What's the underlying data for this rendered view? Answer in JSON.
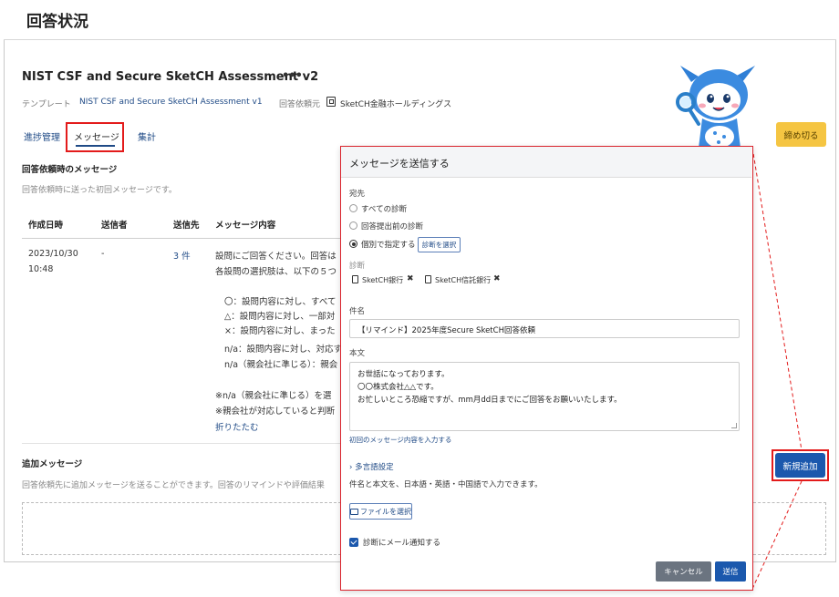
{
  "page": {
    "title": "回答状況"
  },
  "assessment": {
    "title": "NIST CSF and Secure SketCH Assessment v2",
    "more": "•••",
    "template_label": "テンプレート",
    "template_value": "NIST CSF and Secure SketCH Assessment v1",
    "requester_label": "回答依頼元",
    "requester_value": "SketCH金融ホールディングス"
  },
  "tabs": [
    {
      "label": "進捗管理"
    },
    {
      "label": "メッセージ"
    },
    {
      "label": "集計"
    }
  ],
  "request_message": {
    "heading": "回答依頼時のメッセージ",
    "description": "回答依頼時に送った初回メッセージです。",
    "columns": [
      "作成日時",
      "送信者",
      "送信先",
      "メッセージ内容"
    ],
    "row": {
      "date": "2023/10/30",
      "time": "10:48",
      "sender": "-",
      "recipients": "3 件",
      "lines": [
        "設問にご回答ください。回答は",
        "各設問の選択肢は、以下の５つ",
        "",
        "〇：設問内容に対し、すべて",
        "△：設問内容に対し、一部対",
        "×：設問内容に対し、まった",
        "n/a：設問内容に対し、対応す",
        "n/a（親会社に準じる）：親会",
        "",
        "※n/a（親会社に準じる）を選",
        "※親会社が対応していると判断"
      ],
      "collapse": "折りたたむ"
    }
  },
  "additional": {
    "heading": "追加メッセージ",
    "description": "回答依頼先に追加メッセージを送ることができます。回答のリマインドや評価結果"
  },
  "buttons": {
    "close_answers": "締め切る",
    "new": "新規追加"
  },
  "modal": {
    "title": "メッセージを送信する",
    "to_label": "宛先",
    "radios": [
      {
        "label": "すべての診断",
        "selected": false
      },
      {
        "label": "回答提出前の診断",
        "selected": false
      },
      {
        "label": "個別で指定する",
        "selected": true
      }
    ],
    "select_button": "診断を選択",
    "diag_label": "診断",
    "tags": [
      "SketCH銀行",
      "SketCH信託銀行"
    ],
    "tag_remove": "✖",
    "subject_label": "件名",
    "subject_value": "【リマインド】2025年度Secure SketCH回答依頼",
    "body_label": "本文",
    "body_lines": [
      "お世話になっております。",
      "〇〇株式会社△△です。",
      "お忙しいところ恐縮ですが、mm月dd日までにご回答をお願いいたします。"
    ],
    "body_hint": "初回のメッセージ内容を入力する",
    "multilang_link": "多言語設定",
    "multilang_desc": "件名と本文を、日本語・英語・中国語で入力できます。",
    "file_button": "ファイルを選択",
    "notify_label": "診断にメール通知する",
    "notify_checked": true,
    "cancel": "キャンセル",
    "send": "送信"
  },
  "colors": {
    "accent": "#1b58ad",
    "link": "#1f4a86",
    "highlight": "#e31b1b",
    "warning_button": "#f5c542"
  }
}
